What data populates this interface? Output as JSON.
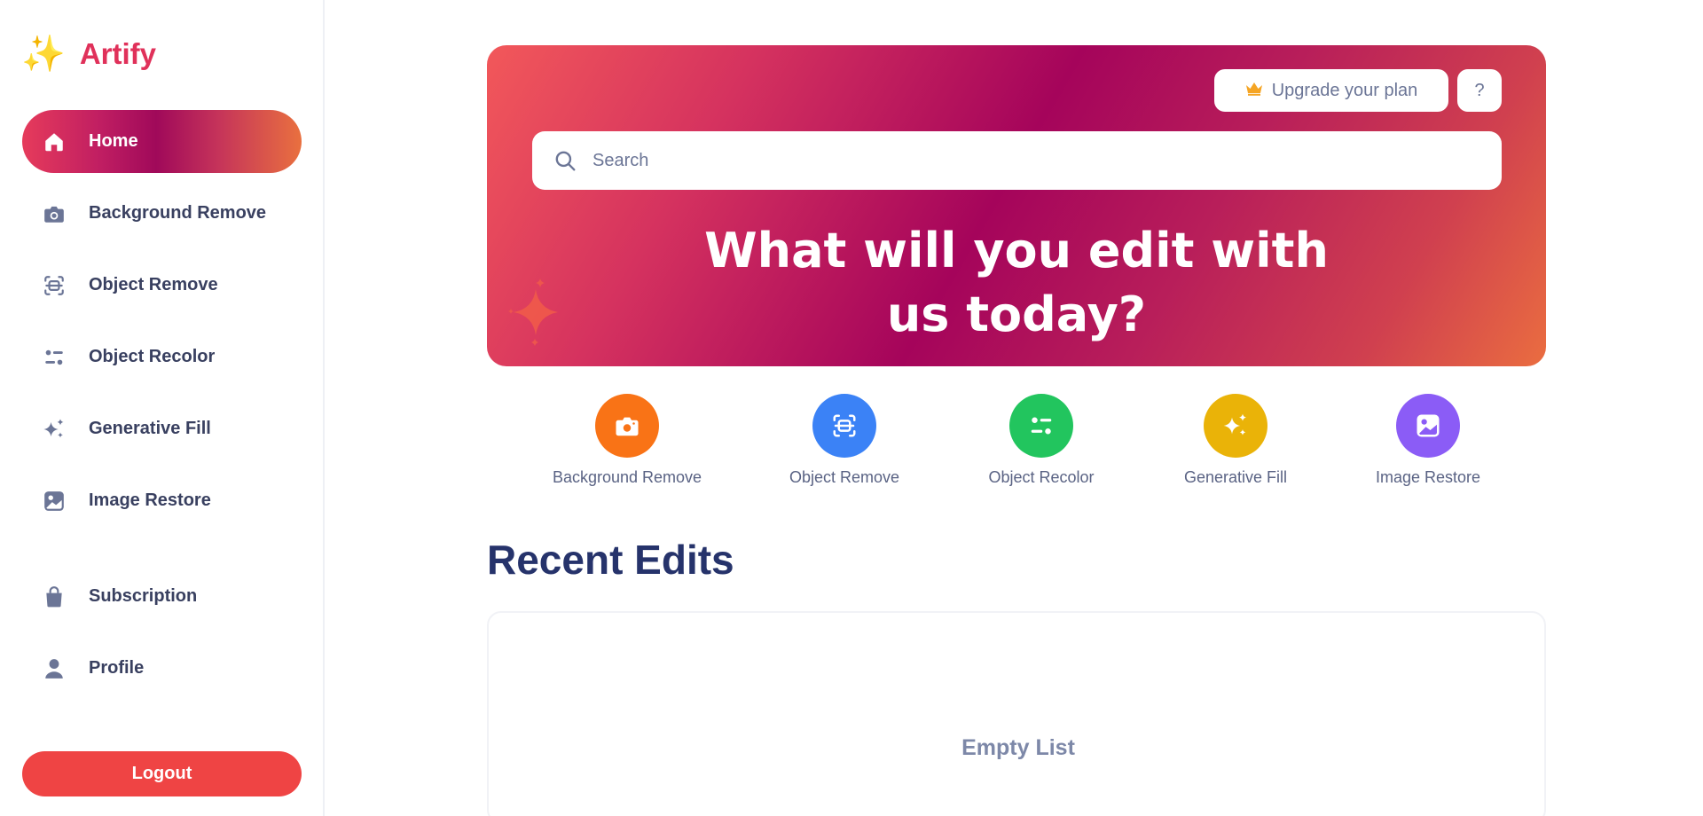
{
  "brand": {
    "logo_icon": "sparkles-icon",
    "name": "Artify"
  },
  "sidebar": {
    "items": [
      {
        "label": "Home",
        "icon": "home-icon",
        "active": true
      },
      {
        "label": "Background Remove",
        "icon": "camera-icon"
      },
      {
        "label": "Object Remove",
        "icon": "scan-object-icon"
      },
      {
        "label": "Object Recolor",
        "icon": "sliders-icon"
      },
      {
        "label": "Generative Fill",
        "icon": "sparkles-icon"
      },
      {
        "label": "Image Restore",
        "icon": "image-icon"
      },
      {
        "label": "Subscription",
        "icon": "shopping-bag-icon"
      },
      {
        "label": "Profile",
        "icon": "user-icon"
      }
    ],
    "logout_label": "Logout"
  },
  "hero": {
    "upgrade_label": "Upgrade your plan",
    "upgrade_icon": "crown-icon",
    "help_label": "?",
    "search_placeholder": "Search",
    "title_line1": "What will you edit with",
    "title_line2": "us today?"
  },
  "tools": [
    {
      "label": "Background Remove",
      "icon": "camera-icon",
      "color": "#f97316"
    },
    {
      "label": "Object Remove",
      "icon": "scan-object-icon",
      "color": "#3b82f6"
    },
    {
      "label": "Object Recolor",
      "icon": "sliders-icon",
      "color": "#22c55e"
    },
    {
      "label": "Generative Fill",
      "icon": "sparkles-icon",
      "color": "#eab308"
    },
    {
      "label": "Image Restore",
      "icon": "image-icon",
      "color": "#8b5cf6"
    }
  ],
  "recent": {
    "title": "Recent Edits",
    "empty_text": "Empty List"
  },
  "colors": {
    "accent": "#e0315a",
    "navy": "#26336b",
    "logout": "#ef4444"
  }
}
